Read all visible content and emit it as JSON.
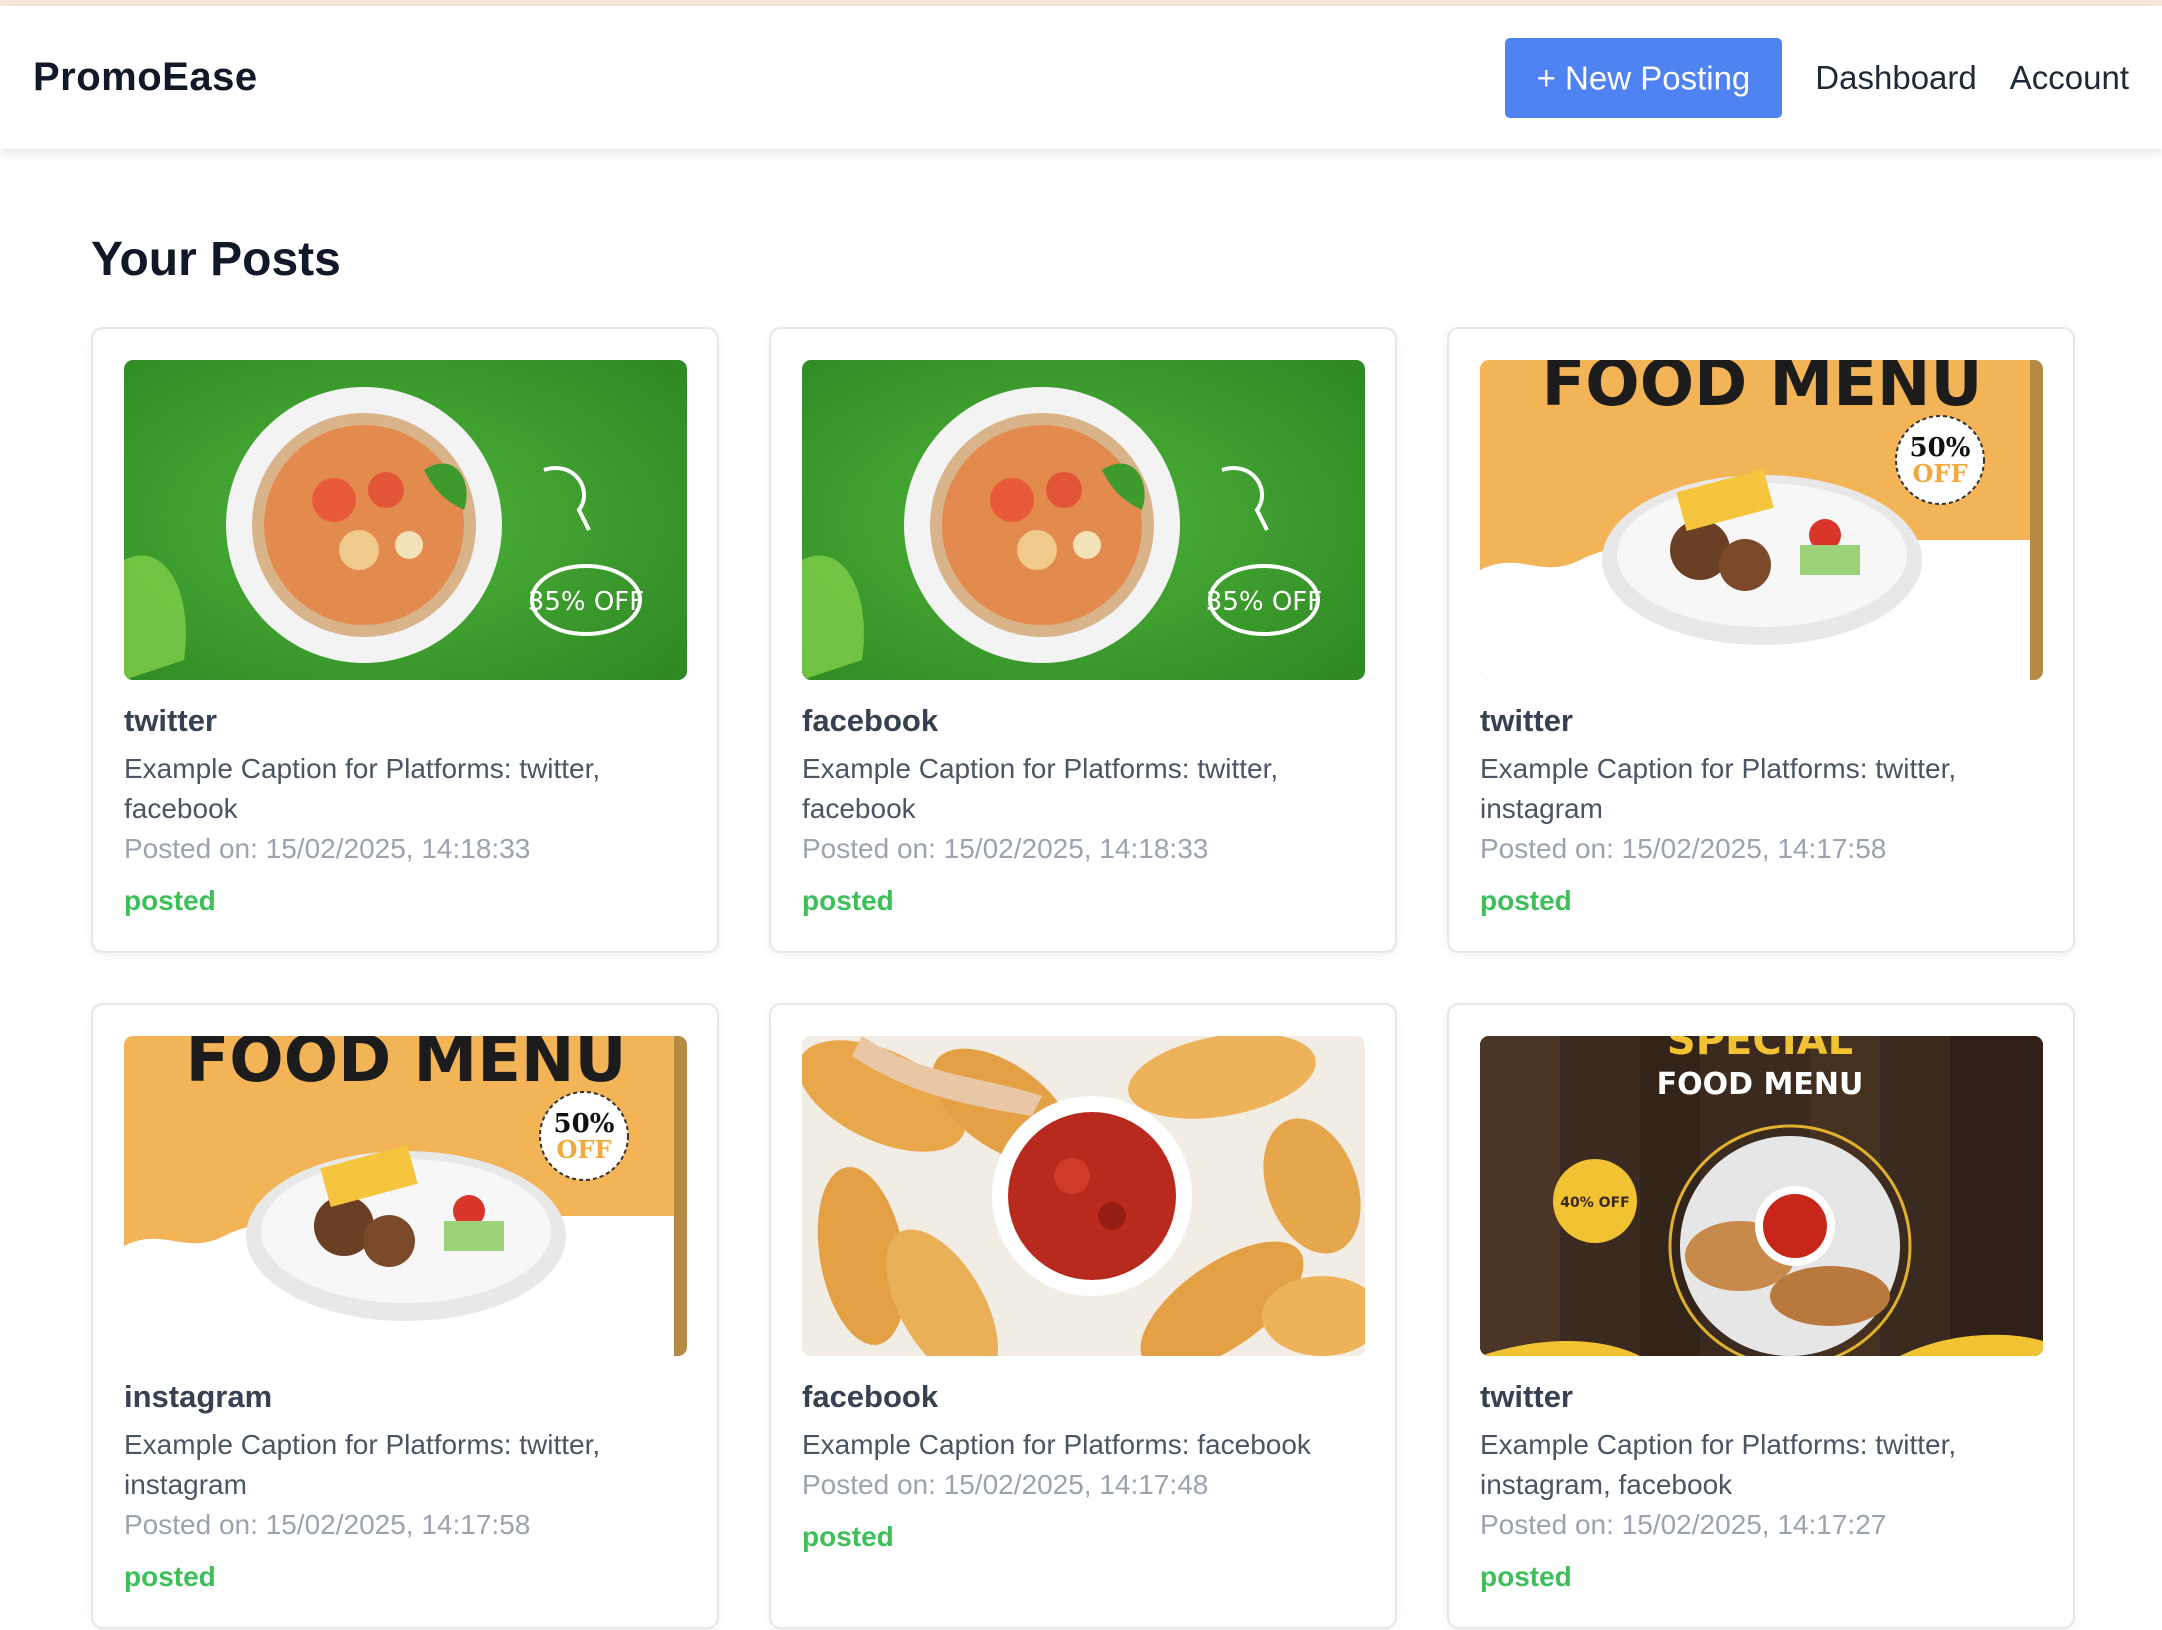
{
  "app": {
    "brand": "PromoEase"
  },
  "nav": {
    "new_posting": "+ New Posting",
    "links": [
      "Dashboard",
      "Account"
    ]
  },
  "main": {
    "title": "Your Posts",
    "posts": [
      {
        "platform": "twitter",
        "caption": "Example Caption for Platforms: twitter, facebook",
        "posted_on": "Posted on: 15/02/2025, 14:18:33",
        "status": "posted",
        "image": "green-noodle-bowl",
        "image_badge": "35% OFF"
      },
      {
        "platform": "facebook",
        "caption": "Example Caption for Platforms: twitter, facebook",
        "posted_on": "Posted on: 15/02/2025, 14:18:33",
        "status": "posted",
        "image": "green-noodle-bowl",
        "image_badge": "35% OFF"
      },
      {
        "platform": "twitter",
        "caption": "Example Caption for Platforms: twitter, instagram",
        "posted_on": "Posted on: 15/02/2025, 14:17:58",
        "status": "posted",
        "image": "orange-food-menu",
        "image_title": "FOOD MENU",
        "image_badge_top": "50%",
        "image_badge_bottom": "OFF"
      },
      {
        "platform": "instagram",
        "caption": "Example Caption for Platforms: twitter, instagram",
        "posted_on": "Posted on: 15/02/2025, 14:17:58",
        "status": "posted",
        "image": "orange-food-menu",
        "image_title": "FOOD MENU",
        "image_badge_top": "50%",
        "image_badge_bottom": "OFF"
      },
      {
        "platform": "facebook",
        "caption": "Example Caption for Platforms: facebook",
        "posted_on": "Posted on: 15/02/2025, 14:17:48",
        "status": "posted",
        "image": "garlic-bread-dip"
      },
      {
        "platform": "twitter",
        "caption": "Example Caption for Platforms: twitter, instagram, facebook",
        "posted_on": "Posted on: 15/02/2025, 14:17:27",
        "status": "posted",
        "image": "dark-wood-food-menu",
        "image_title": "FOOD MENU",
        "image_banner": "SPECIAL",
        "image_badge": "40% OFF"
      }
    ]
  },
  "colors": {
    "accent": "#4f83f1",
    "status_posted": "#3fbf5a",
    "thumb_green": "#3f9a2e",
    "thumb_orange": "#f2b457",
    "thumb_wood": "#3a2a1f"
  }
}
